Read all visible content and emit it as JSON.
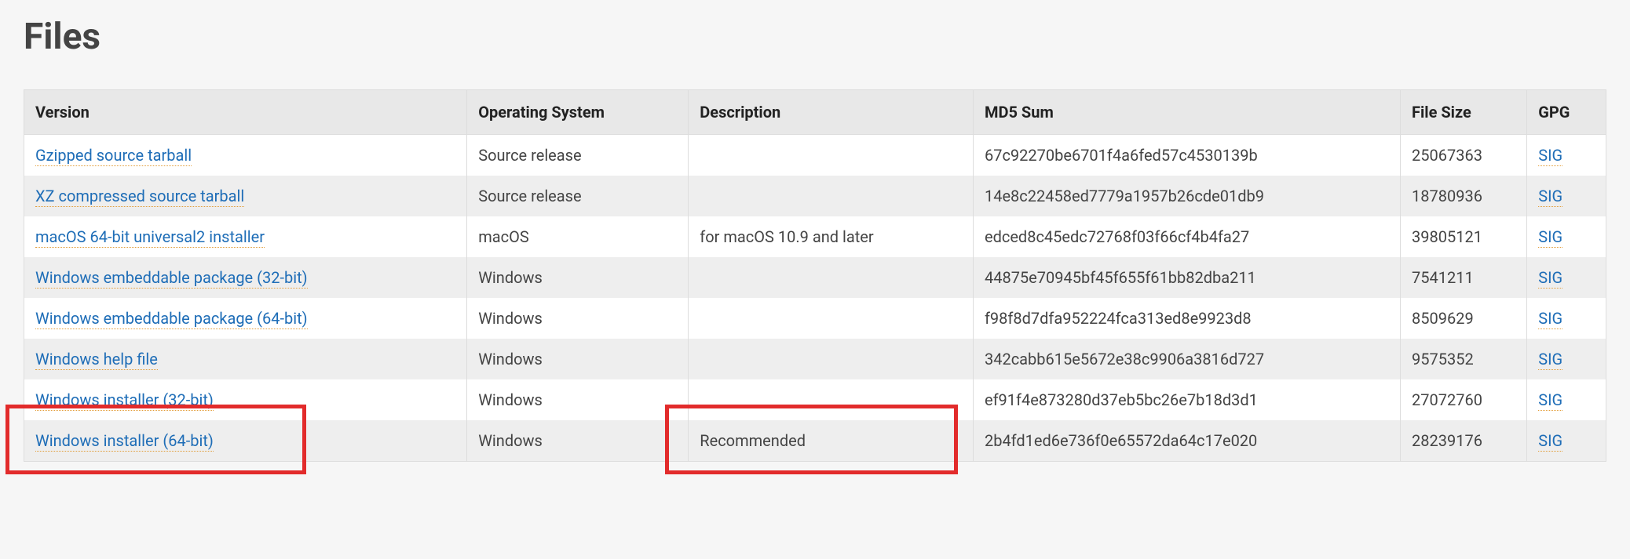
{
  "title": "Files",
  "headers": {
    "version": "Version",
    "os": "Operating System",
    "description": "Description",
    "md5": "MD5 Sum",
    "size": "File Size",
    "gpg": "GPG"
  },
  "sig_label": "SIG",
  "rows": [
    {
      "version": "Gzipped source tarball",
      "os": "Source release",
      "description": "",
      "md5": "67c92270be6701f4a6fed57c4530139b",
      "size": "25067363"
    },
    {
      "version": "XZ compressed source tarball",
      "os": "Source release",
      "description": "",
      "md5": "14e8c22458ed7779a1957b26cde01db9",
      "size": "18780936"
    },
    {
      "version": "macOS 64-bit universal2 installer",
      "os": "macOS",
      "description": "for macOS 10.9 and later",
      "md5": "edced8c45edc72768f03f66cf4b4fa27",
      "size": "39805121"
    },
    {
      "version": "Windows embeddable package (32-bit)",
      "os": "Windows",
      "description": "",
      "md5": "44875e70945bf45f655f61bb82dba211",
      "size": "7541211"
    },
    {
      "version": "Windows embeddable package (64-bit)",
      "os": "Windows",
      "description": "",
      "md5": "f98f8d7dfa952224fca313ed8e9923d8",
      "size": "8509629"
    },
    {
      "version": "Windows help file",
      "os": "Windows",
      "description": "",
      "md5": "342cabb615e5672e38c9906a3816d727",
      "size": "9575352"
    },
    {
      "version": "Windows installer (32-bit)",
      "os": "Windows",
      "description": "",
      "md5": "ef91f4e873280d37eb5bc26e7b18d3d1",
      "size": "27072760"
    },
    {
      "version": "Windows installer (64-bit)",
      "os": "Windows",
      "description": "Recommended",
      "md5": "2b4fd1ed6e736f0e65572da64c17e020",
      "size": "28239176"
    }
  ]
}
